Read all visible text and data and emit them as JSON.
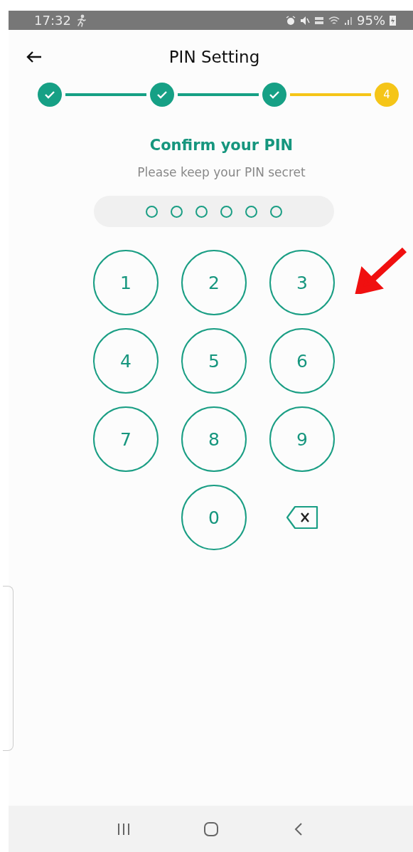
{
  "status_bar": {
    "time": "17:32",
    "battery": "95%"
  },
  "header": {
    "title": "PIN Setting"
  },
  "steps": [
    {
      "done": true
    },
    {
      "done": true
    },
    {
      "done": true
    },
    {
      "done": false,
      "label": "4"
    }
  ],
  "heading": "Confirm your PIN",
  "subtitle": "Please keep your PIN secret",
  "pin_dots": [
    {
      "filled": false
    },
    {
      "filled": false
    },
    {
      "filled": false
    },
    {
      "filled": false
    },
    {
      "filled": false
    },
    {
      "filled": false
    }
  ],
  "keys": [
    {
      "kind": "digit",
      "label": "1"
    },
    {
      "kind": "digit",
      "label": "2"
    },
    {
      "kind": "digit",
      "label": "3"
    },
    {
      "kind": "digit",
      "label": "4"
    },
    {
      "kind": "digit",
      "label": "5"
    },
    {
      "kind": "digit",
      "label": "6"
    },
    {
      "kind": "digit",
      "label": "7"
    },
    {
      "kind": "digit",
      "label": "8"
    },
    {
      "kind": "digit",
      "label": "9"
    },
    {
      "kind": "blank"
    },
    {
      "kind": "digit",
      "label": "0"
    },
    {
      "kind": "backspace"
    }
  ]
}
